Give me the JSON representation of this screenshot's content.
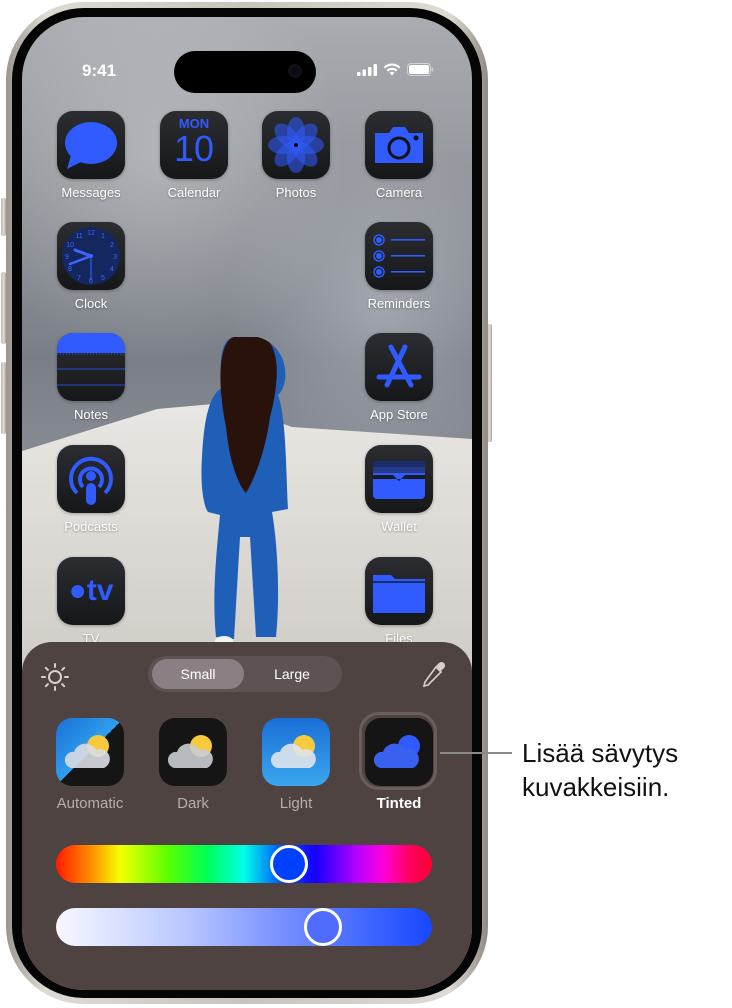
{
  "status_bar": {
    "time": "9:41",
    "icons": [
      "cellular-signal-icon",
      "wifi-icon",
      "battery-icon"
    ]
  },
  "home_screen": {
    "apps": [
      {
        "label": "Messages",
        "icon": "messages-icon"
      },
      {
        "label": "Calendar",
        "icon": "calendar-icon",
        "day": "MON",
        "date": "10"
      },
      {
        "label": "Photos",
        "icon": "photos-icon"
      },
      {
        "label": "Camera",
        "icon": "camera-icon"
      },
      {
        "label": "Clock",
        "icon": "clock-icon"
      },
      {
        "label": "Reminders",
        "icon": "reminders-icon"
      },
      {
        "label": "Notes",
        "icon": "notes-icon"
      },
      {
        "label": "App Store",
        "icon": "app-store-icon"
      },
      {
        "label": "Podcasts",
        "icon": "podcasts-icon"
      },
      {
        "label": "Wallet",
        "icon": "wallet-icon"
      },
      {
        "label": "TV",
        "icon": "tv-icon",
        "glyph": "tv"
      },
      {
        "label": "Files",
        "icon": "files-icon"
      }
    ]
  },
  "customize_panel": {
    "brightness_icon": "sun-icon",
    "eyedropper_icon": "eyedropper-icon",
    "size_toggle": {
      "options": [
        "Small",
        "Large"
      ],
      "selected": "Small"
    },
    "styles": [
      {
        "label": "Automatic",
        "selected": false
      },
      {
        "label": "Dark",
        "selected": false
      },
      {
        "label": "Light",
        "selected": false
      },
      {
        "label": "Tinted",
        "selected": true
      }
    ],
    "hue_slider": {
      "value_fraction": 0.62
    },
    "saturation_slider": {
      "value_fraction": 0.71
    },
    "tint_color": "#1a44ff"
  },
  "callout": {
    "line1": "Lisää sävytys",
    "line2": "kuvakkeisiin."
  },
  "colors": {
    "panel_bg": "#4f4342",
    "accent_blue": "#2f5bff"
  }
}
